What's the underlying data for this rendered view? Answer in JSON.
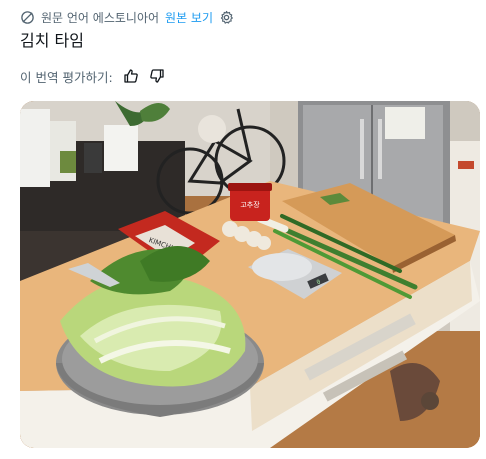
{
  "translation": {
    "source_language_text": "원문 언어 에스토니아어",
    "view_original_label": "원본 보기"
  },
  "post": {
    "title": "김치 타임"
  },
  "rating": {
    "prompt": "이 번역 평가하기:"
  },
  "photo": {
    "jar_label": "고추장",
    "bag_label": "KIMCHI",
    "scale_display": "0"
  },
  "icons": {
    "translate": "globe-slash-icon",
    "settings": "gear-icon",
    "like": "thumbs-up-icon",
    "dislike": "thumbs-down-icon"
  }
}
